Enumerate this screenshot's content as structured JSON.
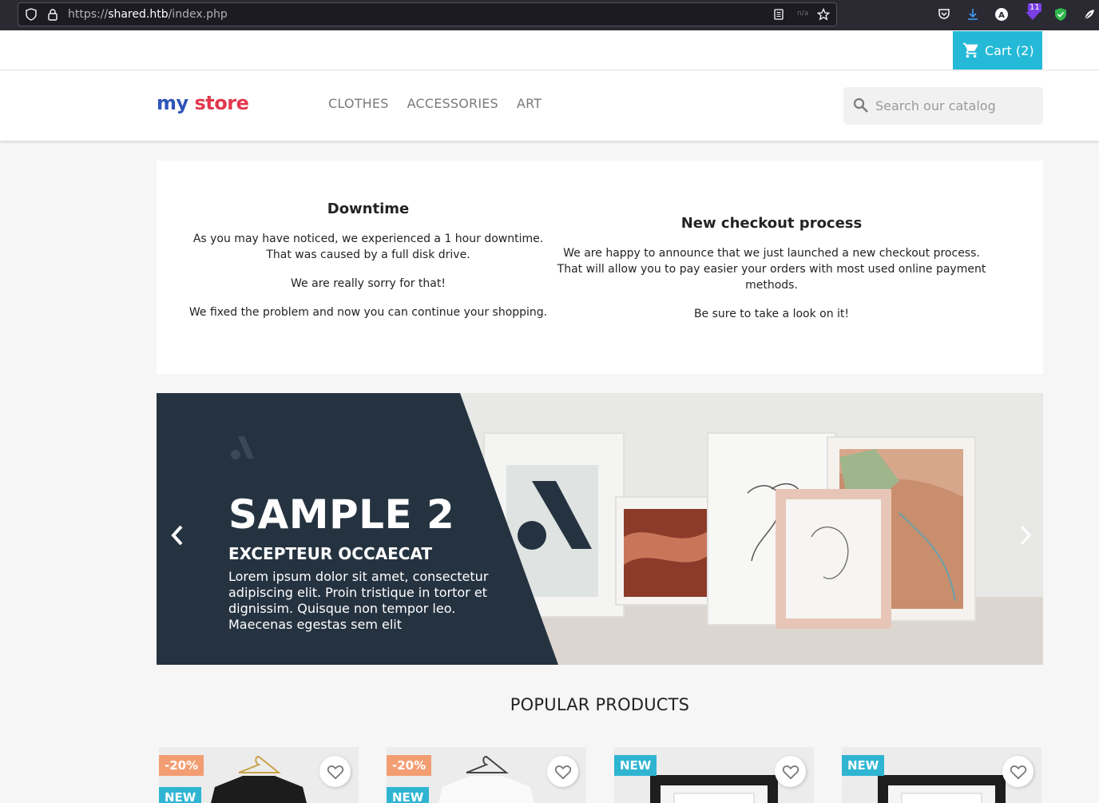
{
  "browser": {
    "url_scheme": "https://",
    "url_host": "shared.htb",
    "url_path": "/index.php",
    "reader_na": "n/a",
    "ext_badge_count": "11"
  },
  "header": {
    "cart_label": "Cart",
    "cart_count": "(2)",
    "logo_my": "my",
    "logo_store": "store",
    "nav": [
      "CLOTHES",
      "ACCESSORIES",
      "ART"
    ],
    "search_placeholder": "Search our catalog"
  },
  "news": {
    "left": {
      "title": "Downtime",
      "p1": "As you may have noticed, we experienced a 1 hour downtime.",
      "p1b": "That was caused by a full disk drive.",
      "p2": "We are really sorry for that!",
      "p3": "We fixed the problem and now you can continue your shopping."
    },
    "right": {
      "title": "New checkout process",
      "p1": "We are happy to announce that we just launched a new checkout process.",
      "p1b": "That will allow you to pay easier your orders with most used online payment methods.",
      "p2": "Be sure to take a look on it!"
    }
  },
  "slider": {
    "title": "SAMPLE 2",
    "subtitle": "EXCEPTEUR OCCAECAT",
    "description": "Lorem ipsum dolor sit amet, consectetur adipiscing elit. Proin tristique in tortor et dignissim. Quisque non tempor leo. Maecenas egestas sem elit"
  },
  "popular": {
    "title": "POPULAR PRODUCTS",
    "products": [
      {
        "discount": "-20%",
        "flag": "NEW"
      },
      {
        "discount": "-20%",
        "flag": "NEW"
      },
      {
        "flag": "NEW"
      },
      {
        "flag": "NEW"
      }
    ]
  },
  "colors": {
    "accent": "#24b9d7",
    "discount": "#f39d72",
    "slider_dark": "#253341"
  }
}
